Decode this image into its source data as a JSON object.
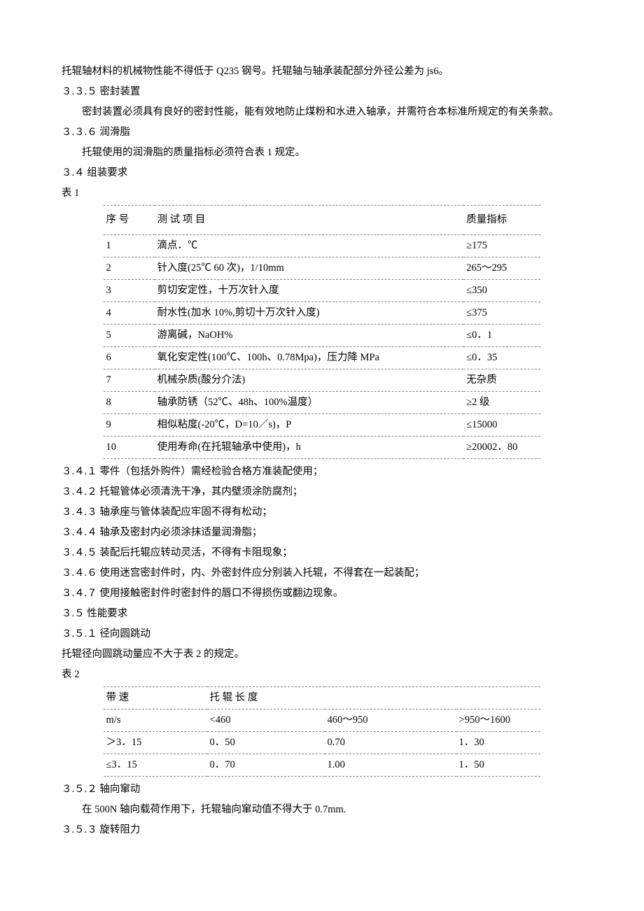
{
  "intro": {
    "line1": "托辊轴材料的机械物性能不得低于 Q235 钢号。托辊轴与轴承装配部分外径公差为 js6。",
    "h335": "３.３.５ 密封装置",
    "p335": "密封装置必须具有良好的密封性能，能有效地防止煤粉和水进入轴承，并需符合本标准所规定的有关条款。",
    "h336": "３.３.６ 润滑脂",
    "p336": "托辊使用的润滑脂的质量指标必须符合表 1 规定。",
    "h34": "３.４   组装要求",
    "t1label": "表 1"
  },
  "table1": {
    "head_no": "序  号",
    "head_item": "测  试  项  目",
    "head_spec": "质量指标",
    "rows": [
      {
        "no": "1",
        "item": "滴点．℃",
        "spec": "≥175"
      },
      {
        "no": "2",
        "item": "针入度(25℃ 60 次)，1/10mm",
        "spec": "265～295"
      },
      {
        "no": "3",
        "item": "剪切安定性，十万次针入度",
        "spec": "≤350"
      },
      {
        "no": "4",
        "item": "耐水性(加水 10%,剪切十万次针入度)",
        "spec": "≤375"
      },
      {
        "no": "5",
        "item": "游离碱，NaOH%",
        "spec": "≤0．1"
      },
      {
        "no": "6",
        "item": "氧化安定性(100℃、100h、0.78Mpa)，压力降 MPa",
        "spec": "≤0．35"
      },
      {
        "no": "7",
        "item": "机械杂质(酸分介法)",
        "spec": "无杂质"
      },
      {
        "no": "8",
        "item": "轴承防锈（52℃、48h、100%温度）",
        "spec": "≥2 级"
      },
      {
        "no": "9",
        "item": "相似粘度(-20℃，D=10／s)，P",
        "spec": "≤15000"
      },
      {
        "no": "10",
        "item": "使用寿命(在托辊轴承中使用)，h",
        "spec": "≥20002．80"
      }
    ]
  },
  "assembly": {
    "i1": "３.４.１   零件（包括外购件）需经检验合格方准装配使用；",
    "i2": "３.４.２   托辊管体必须清洗干净，其内壁须涂防腐剂；",
    "i3": "３.４.３   轴承座与管体装配应牢固不得有松动；",
    "i4": "３.４.４   轴承及密封内必须涂抹适量润滑脂；",
    "i5": "３.４.５   装配后托辊应转动灵活，不得有卡阻现象；",
    "i6": "３.４.６   使用迷宫密封件时，内、外密封件应分别装入托辊，不得套在一起装配；",
    "i7": "３.４.７   使用接触密封件时密封件的唇口不得损伤或翻边现象。"
  },
  "perf": {
    "h35": "３.５   性能要求",
    "h351": "３.５.１   径向圆跳动",
    "p351": "托辊径向圆跳动量应不大于表 2 的规定。",
    "t2label": "表 2"
  },
  "table2": {
    "head_speed": "带  速",
    "head_len": "托  辊  长  度",
    "unit": "m/s",
    "c1": "<460",
    "c2": "460～950",
    "c3": ">950～1600",
    "r1": {
      "speed": "＞3．15",
      "a": "0．50",
      "b": "0.70",
      "c": "1．30"
    },
    "r2": {
      "speed": "≤3．15",
      "a": "0．70",
      "b": "1.00",
      "c": "1．50"
    }
  },
  "tail": {
    "h352": "３.５.２   轴向窜动",
    "p352": "在 500N 轴向载荷作用下，托辊轴向窜动值不得大于 0.7mm.",
    "h353": "３.５.３   旋转阻力"
  }
}
